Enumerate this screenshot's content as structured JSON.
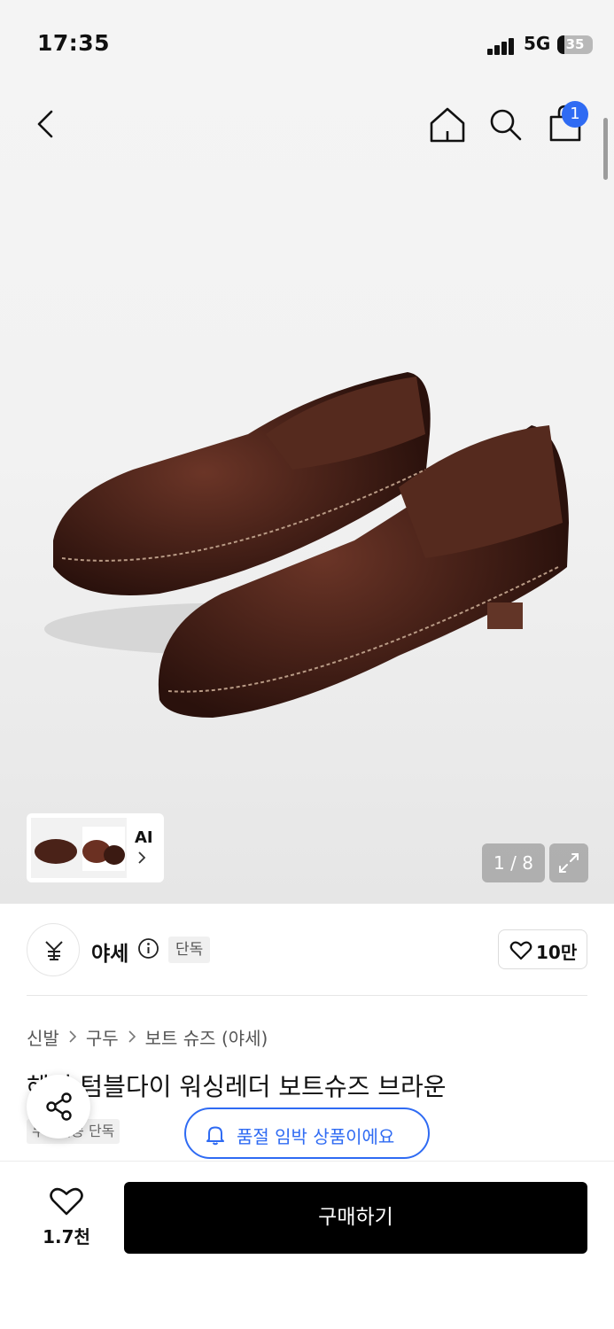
{
  "status_bar": {
    "time": "17:35",
    "network": "5G",
    "battery": "35"
  },
  "header": {
    "back_icon": "chevron-left-icon",
    "home_icon": "home-icon",
    "search_icon": "search-icon",
    "cart_icon": "shopping-bag-icon",
    "cart_badge": "1"
  },
  "gallery": {
    "ai_label": "AI",
    "counter": "1 / 8",
    "expand_icon": "expand-icon"
  },
  "brand": {
    "name": "야세",
    "badge": "단독",
    "like_count": "10만"
  },
  "breadcrumb": [
    "신발",
    "구두",
    "보트 슈즈 (야세)"
  ],
  "product": {
    "title": "헤일 텀블다이 워싱레더 보트슈즈 브라운",
    "free_badge": "무료배송 단독"
  },
  "notice": {
    "text": "품절 임박 상품이에요"
  },
  "bottom": {
    "wish_count": "1.7천",
    "buy_label": "구매하기"
  },
  "colors": {
    "accent": "#2f6bf3",
    "buy_button": "#000000",
    "leather": "#4a2218"
  }
}
